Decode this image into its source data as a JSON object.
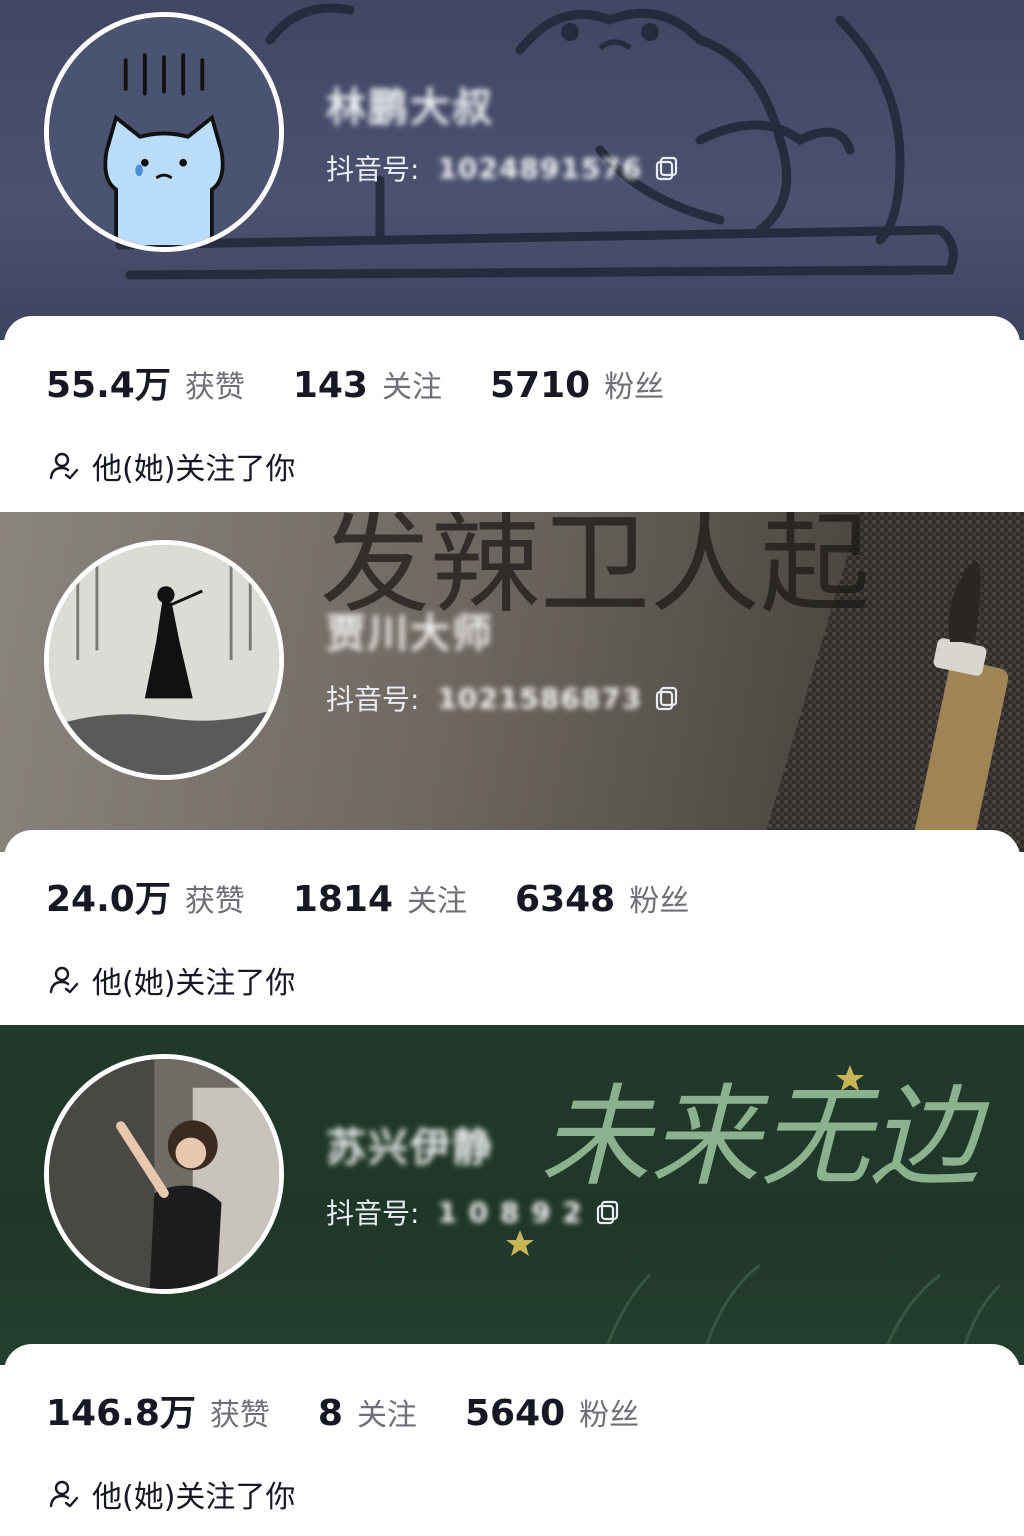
{
  "profiles": [
    {
      "name": "林鹏大叔",
      "id_label": "抖音号:",
      "id_value": "1024891576",
      "likes": "55.4万",
      "likes_label": "获赞",
      "following": "143",
      "following_label": "关注",
      "followers": "5710",
      "followers_label": "粉丝",
      "follow_status": "他(她)关注了你",
      "avatar": "sad-cat-icon"
    },
    {
      "name": "贾川大师",
      "id_label": "抖音号:",
      "id_value": "1021586873",
      "likes": "24.0万",
      "likes_label": "获赞",
      "following": "1814",
      "following_label": "关注",
      "followers": "6348",
      "followers_label": "粉丝",
      "follow_status": "他(她)关注了你",
      "avatar": "ink-swordsman-icon"
    },
    {
      "name": "苏兴伊静",
      "id_label": "抖音号:",
      "id_value": "1 0 8 9 2",
      "likes": "146.8万",
      "likes_label": "获赞",
      "following": "8",
      "following_label": "关注",
      "followers": "5640",
      "followers_label": "粉丝",
      "follow_status": "他(她)关注了你",
      "avatar": "girl-portrait-icon"
    }
  ],
  "banner_texts": {
    "calligraphy": "发辣卫人起",
    "slogan": "未来无边"
  },
  "colors": {
    "banner1": "#434b67",
    "banner2": "#6d6760",
    "banner3": "#223a2c",
    "card_bg": "#ffffff",
    "number": "#161823",
    "label": "#6f7077"
  }
}
